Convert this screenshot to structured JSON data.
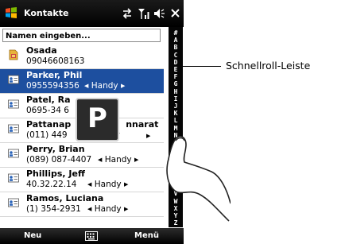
{
  "title": "Kontakte",
  "status_icons": [
    "sync-icon",
    "signal-icon",
    "volume-icon",
    "close-icon"
  ],
  "search": {
    "placeholder": "Namen eingeben..."
  },
  "contacts": [
    {
      "name": "Osada",
      "number": "09046608163",
      "type": "",
      "icon": "sim-contact-icon",
      "selected": false
    },
    {
      "name": "Parker, Phil",
      "number": "0955594356",
      "type": "Handy",
      "icon": "contact-card-icon",
      "selected": true
    },
    {
      "name": "Patel, Ra",
      "number": "0695-34 6",
      "type": "",
      "icon": "contact-card-icon",
      "selected": false
    },
    {
      "name": "Pattanap                  nnarat",
      "number": "(011) 449              ndy",
      "type": "",
      "icon": "contact-card-icon",
      "selected": false
    },
    {
      "name": "Perry, Brian",
      "number": "(089) 087-4407",
      "type": "Handy",
      "icon": "contact-card-icon",
      "selected": false
    },
    {
      "name": "Phillips, Jeff",
      "number": "40.32.22.14",
      "type": "Handy",
      "icon": "contact-card-icon",
      "selected": false
    },
    {
      "name": "Ramos, Luciana",
      "number": "(1) 354-2931",
      "type": "Handy",
      "icon": "contact-card-icon",
      "selected": false
    }
  ],
  "alphabet": [
    "#",
    "A",
    "B",
    "C",
    "D",
    "E",
    "F",
    "G",
    "H",
    "I",
    "J",
    "K",
    "L",
    "M",
    "N",
    "O",
    "P",
    "Q",
    "R",
    "S",
    "T",
    "U",
    "V",
    "W",
    "X",
    "Y",
    "Z"
  ],
  "popup_letter": "P",
  "bottom": {
    "left": "Neu",
    "right": "Menü"
  },
  "callout": "Schnellroll-Leiste",
  "colors": {
    "selection": "#1d4f9f",
    "titlebar": "#000000",
    "alphabar": "#050505"
  }
}
